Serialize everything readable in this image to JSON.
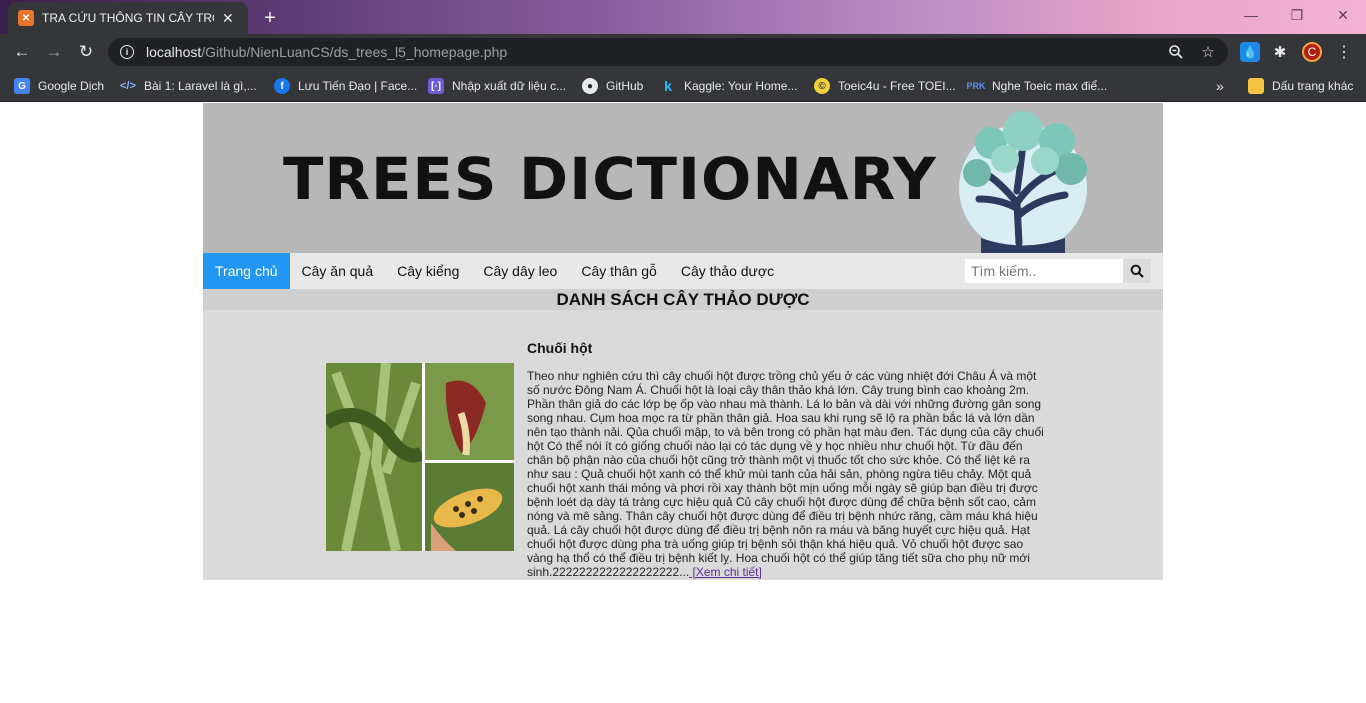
{
  "browser": {
    "tab_title": "TRA CỨU THÔNG TIN CÂY TRỒNG",
    "tab_favicon": "XAMPP",
    "url_host": "localhost",
    "url_path": "/Github/NienLuanCS/ds_trees_l5_homepage.php",
    "bookmarks": [
      {
        "label": "Google Dịch",
        "icon": "google-translate-icon"
      },
      {
        "label": "Bài 1: Laravel là gì,...",
        "icon": "code-icon"
      },
      {
        "label": "Lưu Tiến Đạo | Face...",
        "icon": "facebook-icon"
      },
      {
        "label": "Nhập xuất dữ liệu c...",
        "icon": "code-bracket-icon"
      },
      {
        "label": "GitHub",
        "icon": "github-icon"
      },
      {
        "label": "Kaggle: Your Home...",
        "icon": "kaggle-icon"
      },
      {
        "label": "Toeic4u - Free TOEI...",
        "icon": "toeic-icon"
      },
      {
        "label": "Nghe Toeic max điể...",
        "icon": "toeic-listen-icon"
      }
    ],
    "overflow_label": "»",
    "other_bookmarks": "Dấu trang khác",
    "profile_initial": "C"
  },
  "site": {
    "banner_title": "TREES DICTIONARY",
    "nav": [
      {
        "label": "Trang chủ",
        "active": true
      },
      {
        "label": "Cây ăn quả",
        "active": false
      },
      {
        "label": "Cây kiểng",
        "active": false
      },
      {
        "label": "Cây dây leo",
        "active": false
      },
      {
        "label": "Cây thân gỗ",
        "active": false
      },
      {
        "label": "Cây thảo dược",
        "active": false
      }
    ],
    "search_placeholder": "Tìm kiếm..",
    "section_title": "DANH SÁCH CÂY THẢO DƯỢC",
    "plant": {
      "name": "Chuối hột",
      "description": "Theo như nghiên cứu thì cây chuối hột được trồng chủ yếu ở các vùng nhiệt đới Châu Á và một số nước Đông Nam Á. Chuối hột là loại cây thân thảo khá lớn. Cây trung bình cao khoảng 2m. Phần thân giả do các lớp bẹ ốp vào nhau mà thành. Lá lo bản và dài với những đường gân song song nhau. Cụm hoa mọc ra từ phần thân giả. Hoa sau khi rụng sẽ lộ ra phần bắc lá và lớn dần nên tạo thành nải. Qủa chuối mập, to và bên trong có phần hạt màu đen. Tác dụng của cây chuối hột Có thể nói ít có giống chuối nào lại có tác dụng về y học nhiều như chuối hột. Từ đầu đến chân bộ phận nào của chuối hột cũng trở thành một vị thuốc tốt cho sức khỏe. Có thể liệt kê ra như sau : Quả chuối hột xanh có thể khử mùi tanh của hải sản, phòng ngừa tiêu chảy. Một quả chuối hột xanh thái mỏng và phơi rồi xay thành bột mịn uống mỗi ngày sẽ giúp bạn điều trị được bệnh loét dạ dày tá tràng cực hiệu quả Củ cây chuối hột được dùng để chữa bệnh sốt cao, cảm nóng và mê sảng. Thân cây chuối hột được dùng để điều trị bệnh nhức răng, cầm máu khá hiệu quả. Lá cây chuối hột được dùng để điều trị bệnh nôn ra máu và băng huyết cực hiệu quả. Hạt chuối hột được dùng pha trà uống giúp trị bệnh sỏi thận khá hiệu quả. Vỏ chuối hột được sao vàng hạ thổ có thể điều trị bệnh kiết lỵ. Hoa chuối hột có thể giúp tăng tiết sữa cho phụ nữ mới sinh.2222222222222222222...",
      "more_label": " [Xem chi tiết]"
    }
  },
  "colors": {
    "nav_active": "#2196f3",
    "banner_bg": "#b7b7b7",
    "content_bg": "#dadada"
  }
}
